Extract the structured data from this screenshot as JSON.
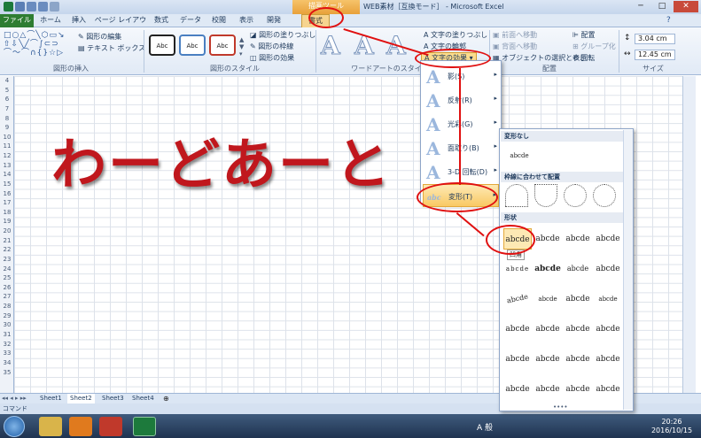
{
  "window": {
    "context_tab_group": "描画ツール",
    "title": "WEB素材［互換モード］ - Microsoft Excel"
  },
  "tabs": [
    "ファイル",
    "ホーム",
    "挿入",
    "ページ レイアウト",
    "数式",
    "データ",
    "校閲",
    "表示",
    "開発",
    "書式"
  ],
  "ribbon": {
    "insert_shapes": {
      "edit_shape": "図形の編集",
      "text_box": "テキスト ボックス",
      "label": "図形の挿入"
    },
    "shape_styles": {
      "swatch_text": "Abc",
      "fill": "図形の塗りつぶし",
      "outline": "図形の枠線",
      "effects": "図形の効果",
      "label": "図形のスタイル"
    },
    "wordart_styles": {
      "glyph": "A",
      "text_fill": "文字の塗りつぶし",
      "text_outline": "文字の輪郭",
      "text_effects": "文字の効果",
      "label": "ワードアートのスタイル"
    },
    "arrange": {
      "bring_forward": "前面へ移動",
      "send_backward": "背面へ移動",
      "selection_pane": "オブジェクトの選択と表示",
      "align": "配置",
      "group": "グループ化",
      "rotate": "回転",
      "label": "配置"
    },
    "size": {
      "height": "3.04 cm",
      "width": "12.45 cm",
      "label": "サイズ"
    }
  },
  "wordart_text": "わーどあーと",
  "rows": [
    "4",
    "5",
    "6",
    "7",
    "8",
    "9",
    "10",
    "11",
    "12",
    "13",
    "14",
    "15",
    "16",
    "17",
    "18",
    "19",
    "20",
    "21",
    "22",
    "23",
    "24",
    "25",
    "26",
    "27",
    "28",
    "29",
    "30",
    "31",
    "32",
    "33",
    "34",
    "35"
  ],
  "effects_menu": [
    {
      "label": "影(S)",
      "glyph": "A"
    },
    {
      "label": "反射(R)",
      "glyph": "A"
    },
    {
      "label": "光彩(G)",
      "glyph": "A"
    },
    {
      "label": "面取り(B)",
      "glyph": "A"
    },
    {
      "label": "3-D 回転(D)",
      "glyph": "A"
    },
    {
      "label": "変形(T)",
      "glyph": "abc"
    }
  ],
  "transform_menu": {
    "no_transform": "変形なし",
    "no_transform_sample": "abcde",
    "follow_path": "枠線に合わせて配置",
    "warp": "形状",
    "tooltip": "凹角",
    "sample": "abcde"
  },
  "sheet_tabs": [
    "Sheet1",
    "Sheet2",
    "Sheet3",
    "Sheet4"
  ],
  "status": "コマンド",
  "clock": {
    "time": "20:26",
    "date": "2016/10/15"
  },
  "ime": "A 般",
  "colors": {
    "highlight": "#e01010",
    "wordart": "#c0171d",
    "file_tab": "#2e7d32"
  }
}
